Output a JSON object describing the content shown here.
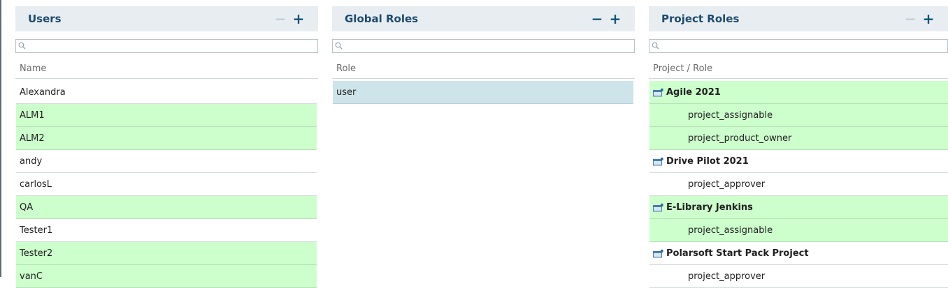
{
  "users": {
    "title": "Users",
    "minus": "−",
    "plus": "+",
    "search_placeholder": "",
    "column": "Name",
    "rows": [
      {
        "label": "Alexandra",
        "highlight": "none"
      },
      {
        "label": "ALM1",
        "highlight": "green"
      },
      {
        "label": "ALM2",
        "highlight": "green"
      },
      {
        "label": "andy",
        "highlight": "none"
      },
      {
        "label": "carlosL",
        "highlight": "none"
      },
      {
        "label": "QA",
        "highlight": "green"
      },
      {
        "label": "Tester1",
        "highlight": "none"
      },
      {
        "label": "Tester2",
        "highlight": "green"
      },
      {
        "label": "vanC",
        "highlight": "green"
      }
    ]
  },
  "global_roles": {
    "title": "Global Roles",
    "minus": "−",
    "plus": "+",
    "search_placeholder": "",
    "column": "Role",
    "rows": [
      {
        "label": "user",
        "highlight": "selected"
      }
    ]
  },
  "project_roles": {
    "title": "Project Roles",
    "minus": "−",
    "plus": "+",
    "search_placeholder": "",
    "column": "Project / Role",
    "rows": [
      {
        "type": "project",
        "label": "Agile 2021",
        "highlight": "green"
      },
      {
        "type": "role",
        "label": "project_assignable",
        "highlight": "green"
      },
      {
        "type": "role",
        "label": "project_product_owner",
        "highlight": "green"
      },
      {
        "type": "project",
        "label": "Drive Pilot 2021",
        "highlight": "none"
      },
      {
        "type": "role",
        "label": "project_approver",
        "highlight": "none"
      },
      {
        "type": "project",
        "label": "E-Library Jenkins",
        "highlight": "green"
      },
      {
        "type": "role",
        "label": "project_assignable",
        "highlight": "green"
      },
      {
        "type": "project",
        "label": "Polarsoft Start Pack Project",
        "highlight": "none"
      },
      {
        "type": "role",
        "label": "project_approver",
        "highlight": "none"
      }
    ]
  },
  "icons": {
    "search": "search-icon",
    "project": "project-folder-icon"
  },
  "colors": {
    "header_bg": "#e8edf1",
    "title": "#1c4a6e",
    "button": "#0e5377",
    "button_disabled": "#c3cdd4",
    "green_row": "#ccffcc",
    "selected_row": "#cde4ea"
  }
}
